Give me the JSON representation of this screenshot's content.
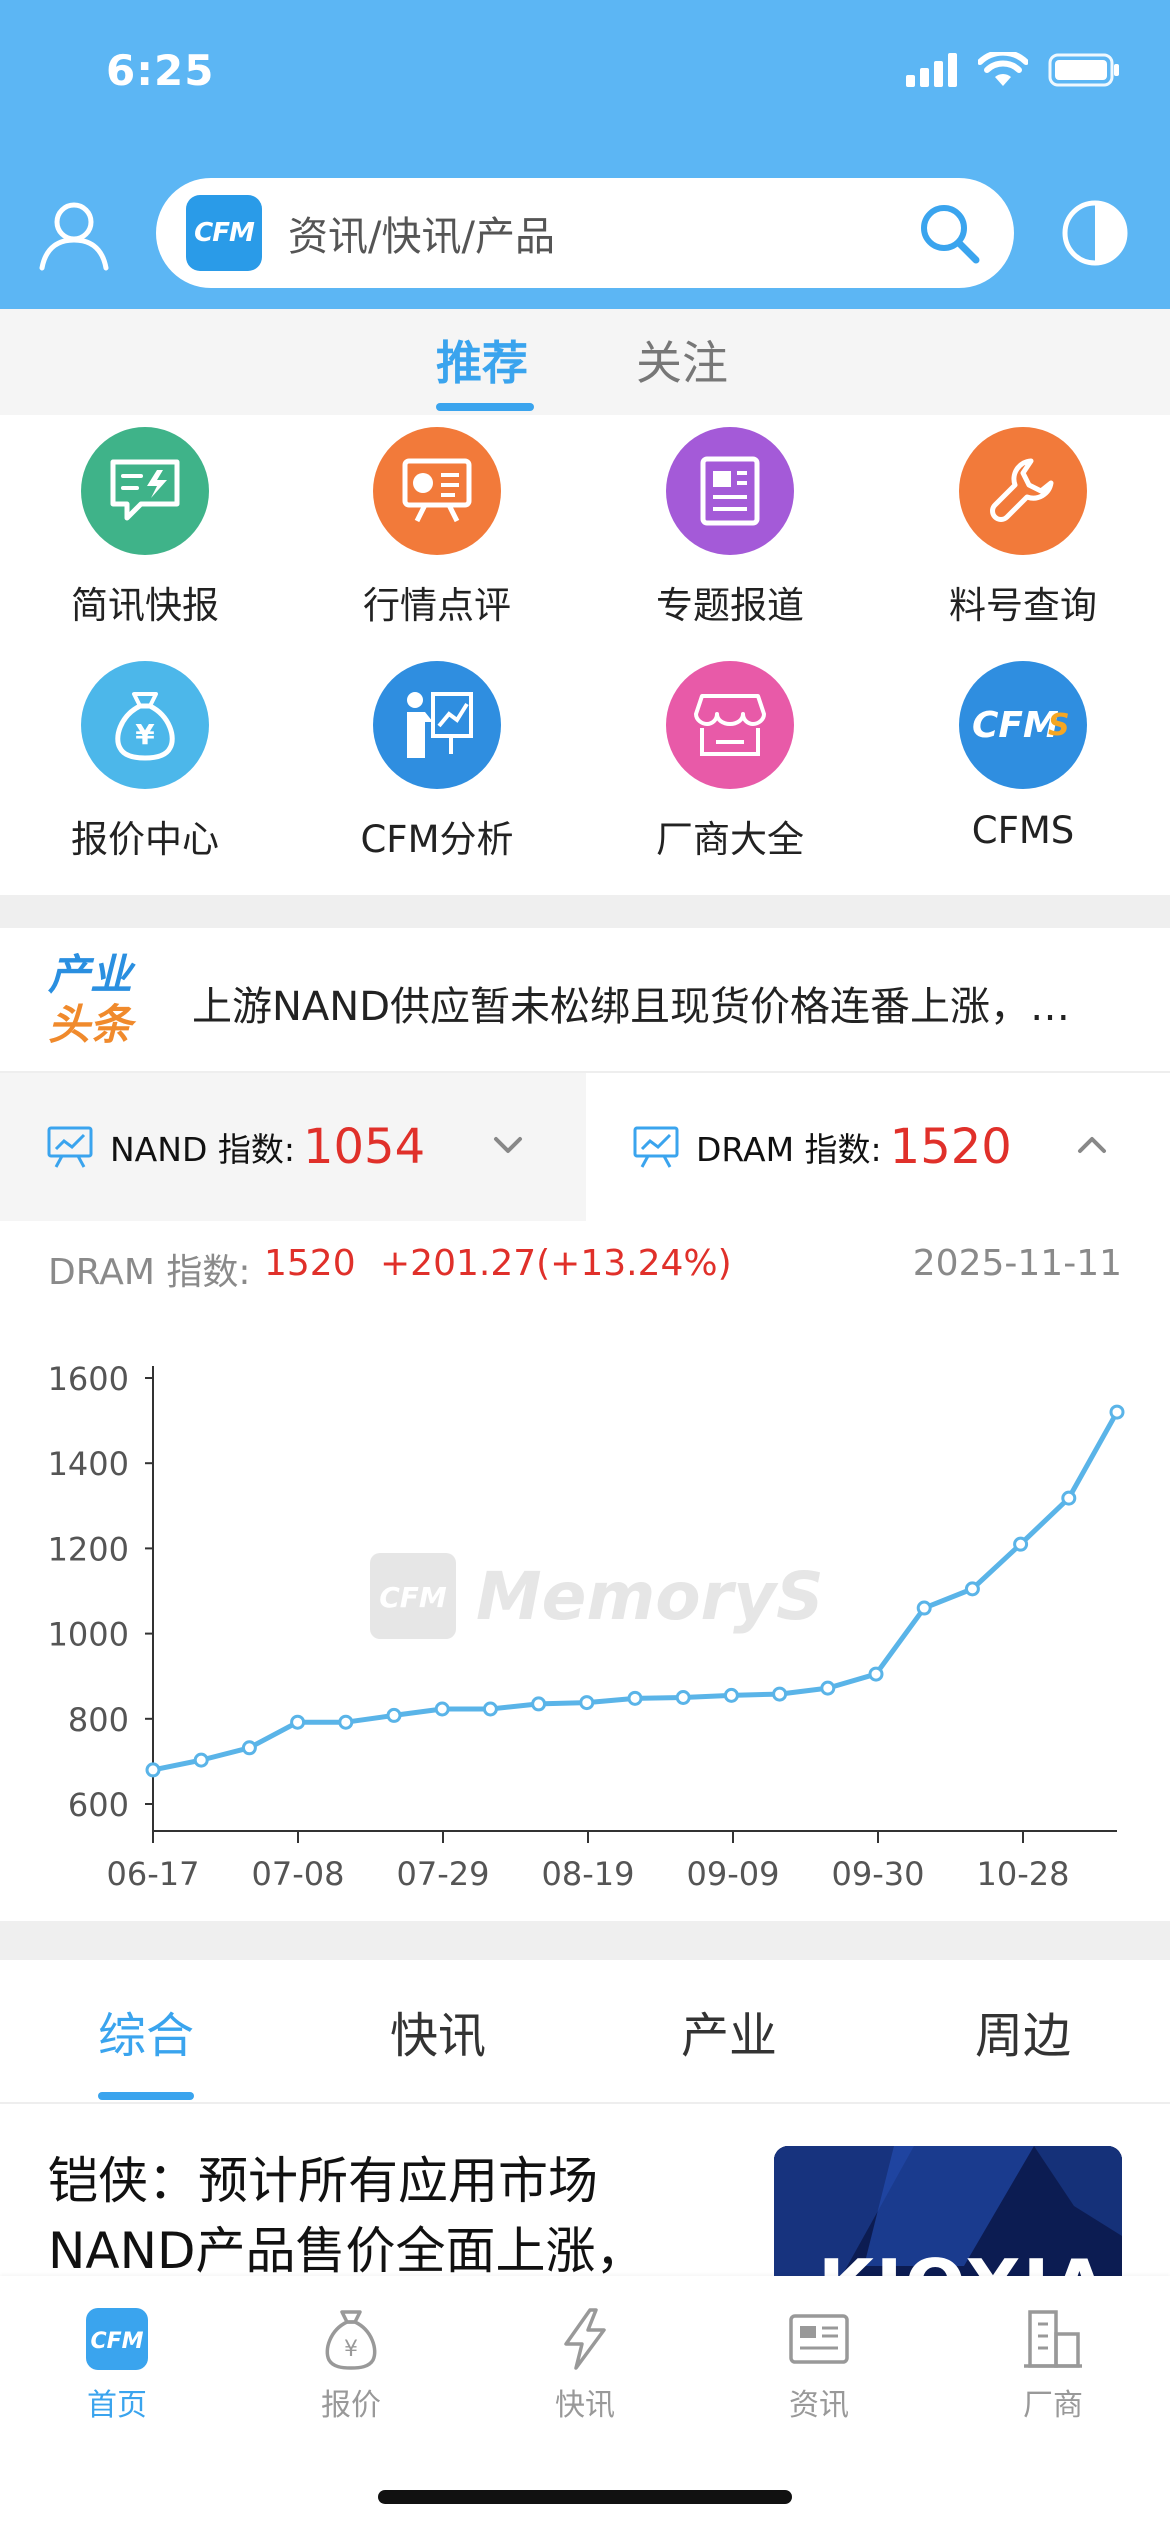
{
  "status_bar": {
    "time": "6:25"
  },
  "header": {
    "search_logo": "CFM",
    "search_placeholder": "资讯/快讯/产品"
  },
  "top_tabs": [
    {
      "label": "推荐",
      "active": true
    },
    {
      "label": "关注",
      "active": false
    }
  ],
  "quick_links": [
    {
      "label": "简讯快报",
      "icon": "message-lightning-icon",
      "color": "#3fb389"
    },
    {
      "label": "行情点评",
      "icon": "presentation-chart-icon",
      "color": "#f27a3a"
    },
    {
      "label": "专题报道",
      "icon": "document-report-icon",
      "color": "#a45ad8"
    },
    {
      "label": "料号查询",
      "icon": "wrench-icon",
      "color": "#f27a3a"
    },
    {
      "label": "报价中心",
      "icon": "money-bag-icon",
      "color": "#4cb7ea"
    },
    {
      "label": "CFM分析",
      "icon": "analyst-board-icon",
      "color": "#2f8ee0"
    },
    {
      "label": "厂商大全",
      "icon": "storefront-icon",
      "color": "#e85aa8"
    },
    {
      "label": "CFMS",
      "icon": "cfms-logo-icon",
      "color": "#2f8ee0"
    }
  ],
  "headline": {
    "badge_line1": "产业",
    "badge_line2": "头条",
    "text": "上游NAND供应暂未松绑且现货价格连番上涨，NAND Flash价格持续走高"
  },
  "index_tabs": {
    "nand": {
      "label": "NAND 指数:",
      "value": "1054"
    },
    "dram": {
      "label": "DRAM 指数:",
      "value": "1520"
    }
  },
  "chart_info": {
    "label": "DRAM 指数:",
    "value": "1520",
    "change": "+201.27(+13.24%)",
    "date": "2025-11-11"
  },
  "chart_data": {
    "type": "line",
    "x_tick_labels": [
      "06-17",
      "07-08",
      "07-29",
      "08-19",
      "09-09",
      "09-30",
      "10-28"
    ],
    "x": [
      "06-17",
      "06-24",
      "07-01",
      "07-08",
      "07-15",
      "07-22",
      "07-29",
      "08-05",
      "08-12",
      "08-19",
      "08-26",
      "09-02",
      "09-09",
      "09-16",
      "09-23",
      "09-30",
      "10-07",
      "10-14",
      "10-21",
      "10-28",
      "11-04",
      "11-11"
    ],
    "series": [
      {
        "values": [
          680,
          703,
          732,
          792,
          792,
          808,
          823,
          823,
          835,
          838,
          848,
          850,
          855,
          858,
          872,
          905,
          1060,
          1105,
          1210,
          1318,
          1520
        ]
      }
    ],
    "ylim": [
      600,
      1600
    ],
    "y_ticks": [
      600,
      800,
      1000,
      1200,
      1400,
      1600
    ],
    "watermark": "CFM MemoryS",
    "line_color": "#5ab4e8"
  },
  "news_tabs": [
    {
      "label": "综合",
      "active": true
    },
    {
      "label": "快讯",
      "active": false
    },
    {
      "label": "产业",
      "active": false
    },
    {
      "label": "周边",
      "active": false
    }
  ],
  "news_items": [
    {
      "title_line1": "铠侠：预计所有应用市场",
      "title_line2": "NAND产品售价全面上涨，",
      "thumb_text": "KIOXIA"
    }
  ],
  "bottom_nav": [
    {
      "label": "首页",
      "icon": "home-cfm-icon",
      "active": true
    },
    {
      "label": "报价",
      "icon": "price-bag-icon",
      "active": false
    },
    {
      "label": "快讯",
      "icon": "flash-icon",
      "active": false
    },
    {
      "label": "资讯",
      "icon": "newspaper-icon",
      "active": false
    },
    {
      "label": "厂商",
      "icon": "building-icon",
      "active": false
    }
  ]
}
